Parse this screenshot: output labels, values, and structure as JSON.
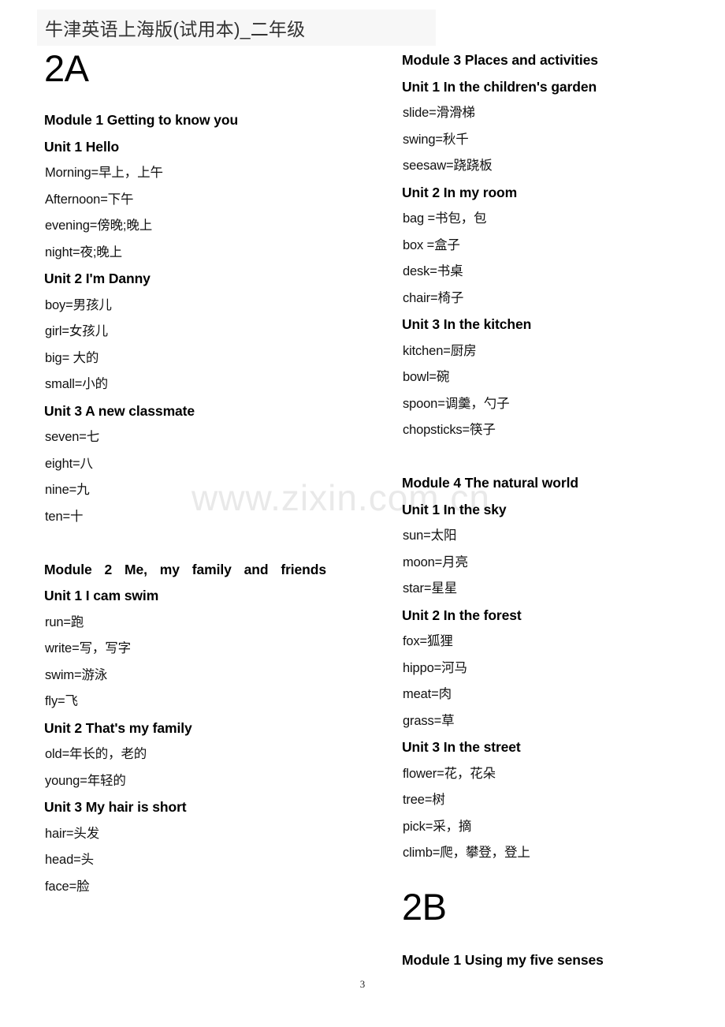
{
  "header": {
    "title": "牛津英语上海版(试用本)_二年级"
  },
  "watermark": {
    "text": "www.zixin.com.cn"
  },
  "page_number": "3",
  "left_column": {
    "volume_label": "2A",
    "blocks": [
      {
        "type": "module",
        "text": "Module 1 Getting to know you"
      },
      {
        "type": "unit",
        "text": "Unit 1 Hello"
      },
      {
        "type": "entry",
        "text": "Morning=早上，上午"
      },
      {
        "type": "entry",
        "text": "Afternoon=下午"
      },
      {
        "type": "entry",
        "text": "evening=傍晚;晚上"
      },
      {
        "type": "entry",
        "text": "night=夜;晚上"
      },
      {
        "type": "unit",
        "text": "Unit 2 I'm Danny"
      },
      {
        "type": "entry",
        "text": "boy=男孩儿"
      },
      {
        "type": "entry",
        "text": "girl=女孩儿"
      },
      {
        "type": "entry",
        "text": "big= 大的"
      },
      {
        "type": "entry",
        "text": "small=小的"
      },
      {
        "type": "unit",
        "text": "Unit 3 A new classmate"
      },
      {
        "type": "entry",
        "text": "seven=七"
      },
      {
        "type": "entry",
        "text": "eight=八"
      },
      {
        "type": "entry",
        "text": "nine=九"
      },
      {
        "type": "entry",
        "text": "ten=十"
      },
      {
        "type": "blank",
        "text": ""
      },
      {
        "type": "module-justified",
        "text": "Module 2 Me, my family and friends"
      },
      {
        "type": "unit",
        "text": "Unit 1 I cam swim"
      },
      {
        "type": "entry",
        "text": "run=跑"
      },
      {
        "type": "entry",
        "text": "write=写，写字"
      },
      {
        "type": "entry",
        "text": "swim=游泳"
      },
      {
        "type": "entry",
        "text": "fly=飞"
      },
      {
        "type": "unit",
        "text": "Unit 2 That's my family"
      },
      {
        "type": "entry",
        "text": "old=年长的，老的"
      },
      {
        "type": "entry",
        "text": "young=年轻的"
      },
      {
        "type": "unit",
        "text": "Unit 3 My hair is short"
      },
      {
        "type": "entry",
        "text": "hair=头发"
      },
      {
        "type": "entry",
        "text": "head=头"
      },
      {
        "type": "entry",
        "text": "face=脸"
      }
    ]
  },
  "right_column": {
    "blocks": [
      {
        "type": "module",
        "text": "Module 3 Places and activities"
      },
      {
        "type": "unit",
        "text": "Unit 1 In the children's garden"
      },
      {
        "type": "entry",
        "text": "slide=滑滑梯"
      },
      {
        "type": "entry",
        "text": "swing=秋千"
      },
      {
        "type": "entry",
        "text": "seesaw=跷跷板"
      },
      {
        "type": "unit",
        "text": "Unit 2 In my room"
      },
      {
        "type": "entry",
        "text": "bag =书包，包"
      },
      {
        "type": "entry",
        "text": "box =盒子"
      },
      {
        "type": "entry",
        "text": "desk=书桌"
      },
      {
        "type": "entry",
        "text": "chair=椅子"
      },
      {
        "type": "unit",
        "text": "Unit 3 In the kitchen"
      },
      {
        "type": "entry",
        "text": "kitchen=厨房"
      },
      {
        "type": "entry",
        "text": "bowl=碗"
      },
      {
        "type": "entry",
        "text": "spoon=调羹，勺子"
      },
      {
        "type": "entry",
        "text": "chopsticks=筷子"
      },
      {
        "type": "blank",
        "text": ""
      },
      {
        "type": "module",
        "text": "Module 4 The natural world"
      },
      {
        "type": "unit",
        "text": "Unit 1 In the sky"
      },
      {
        "type": "entry",
        "text": "sun=太阳"
      },
      {
        "type": "entry",
        "text": "moon=月亮"
      },
      {
        "type": "entry",
        "text": "star=星星"
      },
      {
        "type": "unit",
        "text": "Unit 2 In the forest"
      },
      {
        "type": "entry",
        "text": "fox=狐狸"
      },
      {
        "type": "entry",
        "text": "hippo=河马"
      },
      {
        "type": "entry",
        "text": "meat=肉"
      },
      {
        "type": "entry",
        "text": "grass=草"
      },
      {
        "type": "unit",
        "text": "Unit 3 In the street"
      },
      {
        "type": "entry",
        "text": "flower=花，花朵"
      },
      {
        "type": "entry",
        "text": "tree=树"
      },
      {
        "type": "entry",
        "text": "pick=采，摘"
      },
      {
        "type": "entry",
        "text": "climb=爬，攀登，登上"
      },
      {
        "type": "blank-half",
        "text": ""
      },
      {
        "type": "volume",
        "text": "2B"
      },
      {
        "type": "blank-half",
        "text": ""
      },
      {
        "type": "module",
        "text": "Module 1 Using my five senses"
      }
    ]
  }
}
